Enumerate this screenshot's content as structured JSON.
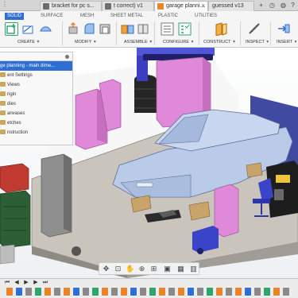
{
  "tabs": [
    {
      "label": "bracket for pc s...",
      "active": false
    },
    {
      "label": "t correct) v1",
      "active": false
    },
    {
      "label": "garage planni...",
      "active": true
    },
    {
      "label": "guessed v13",
      "active": false
    }
  ],
  "ribbon": {
    "tabs": [
      "SOLID",
      "SURFACE",
      "MESH",
      "SHEET METAL",
      "PLASTIC",
      "UTILITIES"
    ],
    "groups": [
      "CREATE",
      "MODIFY",
      "ASSEMBLE",
      "CONFIGURE",
      "CONSTRUCT",
      "INSPECT",
      "INSERT"
    ]
  },
  "browser": {
    "root": "ge planning - main dime...",
    "items": [
      "ent Settings",
      "Views",
      "rigin",
      "dies",
      "anvases",
      "etches",
      "nstruction"
    ]
  },
  "colors": {
    "accent": "#2f6fd3",
    "pink": "#e089d9",
    "car": "#b9cbe8",
    "floor": "#c9c4bc",
    "wall_red": "#c23b32",
    "cabinet_green": "#2e5e36",
    "chair_blue": "#3a44c8",
    "tire": "#262626"
  }
}
